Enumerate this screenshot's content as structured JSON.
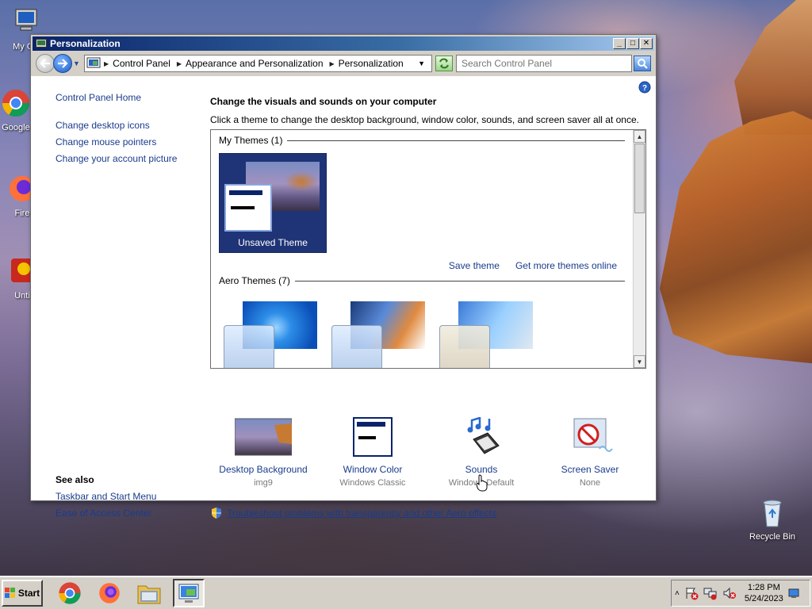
{
  "window": {
    "title": "Personalization",
    "controls": {
      "minimize": "_",
      "maximize": "□",
      "close": "✕"
    }
  },
  "address": {
    "crumbs": [
      "Control Panel",
      "Appearance and Personalization",
      "Personalization"
    ],
    "search_placeholder": "Search Control Panel"
  },
  "sidebar": {
    "home": "Control Panel Home",
    "links": [
      "Change desktop icons",
      "Change mouse pointers",
      "Change your account picture"
    ],
    "see_also_title": "See also",
    "see_also": [
      "Taskbar and Start Menu",
      "Ease of Access Center"
    ]
  },
  "main": {
    "heading": "Change the visuals and sounds on your computer",
    "subtext": "Click a theme to change the desktop background, window color, sounds, and screen saver all at once.",
    "my_themes": "My Themes (1)",
    "unsaved_theme": "Unsaved Theme",
    "save_theme": "Save theme",
    "more_themes": "Get more themes online",
    "aero_themes": "Aero Themes (7)",
    "items": [
      {
        "title": "Desktop Background",
        "sub": "img9"
      },
      {
        "title": "Window Color",
        "sub": "Windows Classic"
      },
      {
        "title": "Sounds",
        "sub": "Windows Default"
      },
      {
        "title": "Screen Saver",
        "sub": "None"
      }
    ],
    "troubleshoot": "Troubleshoot problems with transparency and other Aero effects"
  },
  "desktop_icons": [
    "My Co",
    "Google",
    "Fire",
    "Unti",
    "Recycle Bin"
  ],
  "taskbar": {
    "start": "Start",
    "time": "1:28 PM",
    "date": "5/24/2023"
  },
  "colors": {
    "link": "#1a3c8c",
    "title_bar": "#0a246a",
    "theme_tile": "#1f3476"
  }
}
